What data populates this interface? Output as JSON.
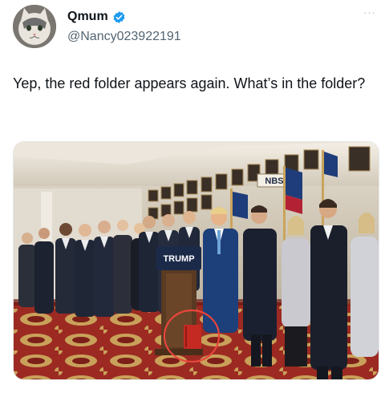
{
  "author": {
    "display_name": "Qmum",
    "handle": "@Nancy023922191",
    "avatar_icon": "cat-avatar-icon",
    "verified_icon": "verified-badge-icon",
    "more_label": "···"
  },
  "tweet": {
    "text": "Yep, the red folder appears again. What’s in the folder?"
  },
  "media": {
    "description_icon": "press-event-photo",
    "podium_sign": "TRUMP",
    "backdrop_sign": "NBS",
    "highlight_color": "#e8463c"
  },
  "colors": {
    "text_primary": "#0f1419",
    "text_secondary": "#536471",
    "verified": "#1d9bf0"
  }
}
